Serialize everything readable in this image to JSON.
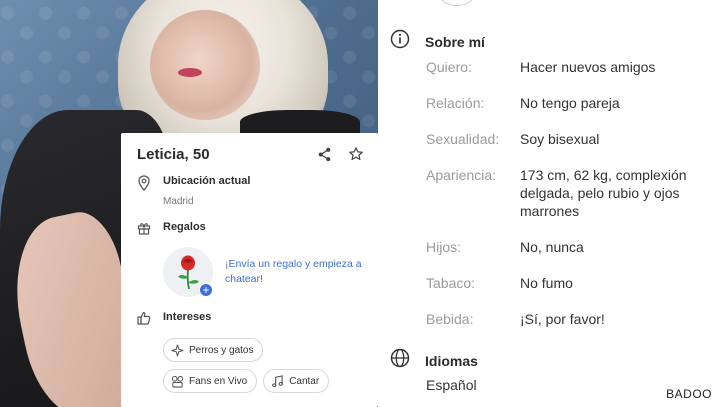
{
  "credit": "BADOO",
  "profile": {
    "name": "Leticia, 50",
    "location_label": "Ubicación actual",
    "location_value": "Madrid",
    "gifts_label": "Regalos",
    "gift_prompt": "¡Envía un regalo y empieza a chatear!",
    "interests_label": "Intereses",
    "interests": [
      "Perros y gatos",
      "Fans en Vivo",
      "Cantar"
    ]
  },
  "about": {
    "title": "Sobre mí",
    "facts": [
      {
        "key": "Quiero:",
        "value": "Hacer nuevos amigos"
      },
      {
        "key": "Relación:",
        "value": "No tengo pareja"
      },
      {
        "key": "Sexualidad:",
        "value": "Soy bisexual"
      },
      {
        "key": "Apariencia:",
        "value": "173 cm, 62 kg, complexión delgada, pelo rubio y ojos marrones"
      },
      {
        "key": "Hijos:",
        "value": "No, nunca"
      },
      {
        "key": "Tabaco:",
        "value": "No fumo"
      },
      {
        "key": "Bebida:",
        "value": "¡Sí, por favor!"
      }
    ]
  },
  "languages": {
    "title": "Idiomas",
    "value": "Español"
  },
  "icons": {
    "share": "share-icon",
    "favorite": "star-icon",
    "location": "location-pin-icon",
    "gift": "gift-icon",
    "interests": "thumbs-up-icon",
    "info": "info-icon",
    "languages": "globe-icon"
  },
  "colors": {
    "accent": "#3d6fd6",
    "muted_label": "#9a9aa0"
  }
}
